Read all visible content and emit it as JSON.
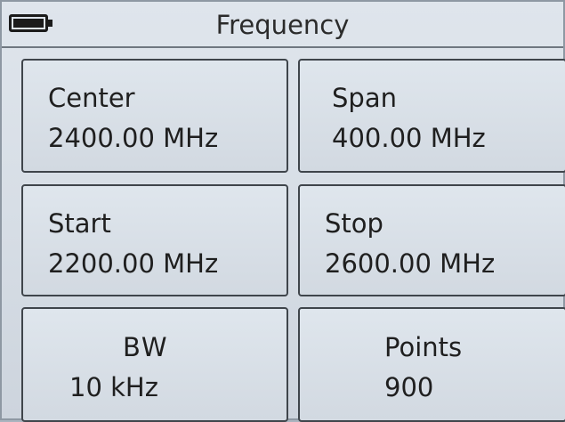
{
  "header": {
    "title": "Frequency",
    "icons": {
      "battery": "battery-icon"
    }
  },
  "settings": [
    {
      "label": "Center",
      "value": "2400.00 MHz"
    },
    {
      "label": "Span",
      "value": "400.00 MHz"
    },
    {
      "label": "Start",
      "value": "2200.00 MHz"
    },
    {
      "label": "Stop",
      "value": "2600.00 MHz"
    },
    {
      "label": "BW",
      "value": "10 kHz"
    },
    {
      "label": "Points",
      "value": "900"
    }
  ]
}
